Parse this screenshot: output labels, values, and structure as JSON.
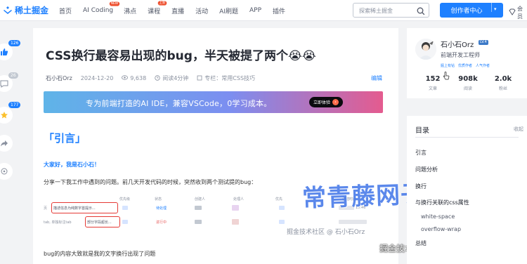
{
  "header": {
    "logo_text": "稀土掘金",
    "nav": [
      {
        "label": "首页",
        "badge": ""
      },
      {
        "label": "AI Coding",
        "badge": "NEW"
      },
      {
        "label": "沸点",
        "badge": ""
      },
      {
        "label": "课程",
        "badge": "上新"
      },
      {
        "label": "直播",
        "badge": ""
      },
      {
        "label": "活动",
        "badge": ""
      },
      {
        "label": "AI刷题",
        "badge": ""
      },
      {
        "label": "APP",
        "badge": ""
      },
      {
        "label": "插件",
        "badge": ""
      }
    ],
    "search_placeholder": "探索稀土掘金",
    "creator_label": "创作者中心",
    "vip_label": "会员"
  },
  "rail": {
    "like_count": "126",
    "comment_count": "26",
    "collect_count": "177"
  },
  "article": {
    "title": "CSS换行最容易出现的bug，半天被提了两个😭😭",
    "author": "石小石Orz",
    "date": "2024-12-20",
    "views": "9,638",
    "read_time": "阅读4分钟",
    "column_prefix": "专栏：",
    "column": "常用CSS技巧",
    "edit_label": "编辑",
    "banner_text": "专为前端打造的AI IDE，兼容VSCode，0学习成本。",
    "banner_button": "立即体验",
    "h2": "「引言」",
    "greeting": "大家好，我是石小石！",
    "intro": "分享一下我工作中遇到的问题。前几天开发代码的时候，突然收到两个测试提的bug：",
    "table_headers": [
      "优先级",
      "状态",
      "创建人",
      "处理人",
      "优先",
      "创建时间"
    ],
    "row1_label": "页",
    "row1_desc": "描述信息为纯数字首提示...",
    "row1_status": "待处理",
    "row1_time": "15:46",
    "row2_label": "tab, 单独标注tab",
    "row2_desc": "部分字段超长...",
    "row2_status": "进行中",
    "footer_text": "bug的内容大致就是我的文字换行出现了问题",
    "watermark_main": "常青藤网子",
    "watermark_small": "掘金技术社区 @ 石小石Orz",
    "watermark_corner": "掘金技术社区 @ 石小石Orz"
  },
  "author_card": {
    "name": "石小石Orz",
    "level": "LV.4",
    "title": "前端开发工程师",
    "tags": [
      "掘上有钻",
      "优质作者",
      "人气作者"
    ],
    "stats": [
      {
        "value": "152",
        "label": "文章"
      },
      {
        "value": "908k",
        "label": "阅读"
      },
      {
        "value": "2.0k",
        "label": "粉丝"
      }
    ]
  },
  "toc": {
    "heading": "目录",
    "fold_label": "收起",
    "items": [
      {
        "label": "引言",
        "level": 1
      },
      {
        "label": "问题分析",
        "level": 1
      },
      {
        "label": "换行",
        "level": 1
      },
      {
        "label": "与换行关联的css属性",
        "level": 1
      },
      {
        "label": "white-space",
        "level": 2
      },
      {
        "label": "overflow-wrap",
        "level": 2
      },
      {
        "label": "总结",
        "level": 1
      }
    ]
  },
  "colors": {
    "accent": "#1e80ff",
    "text": "#252933",
    "muted": "#8a919f",
    "danger": "#e53935"
  }
}
